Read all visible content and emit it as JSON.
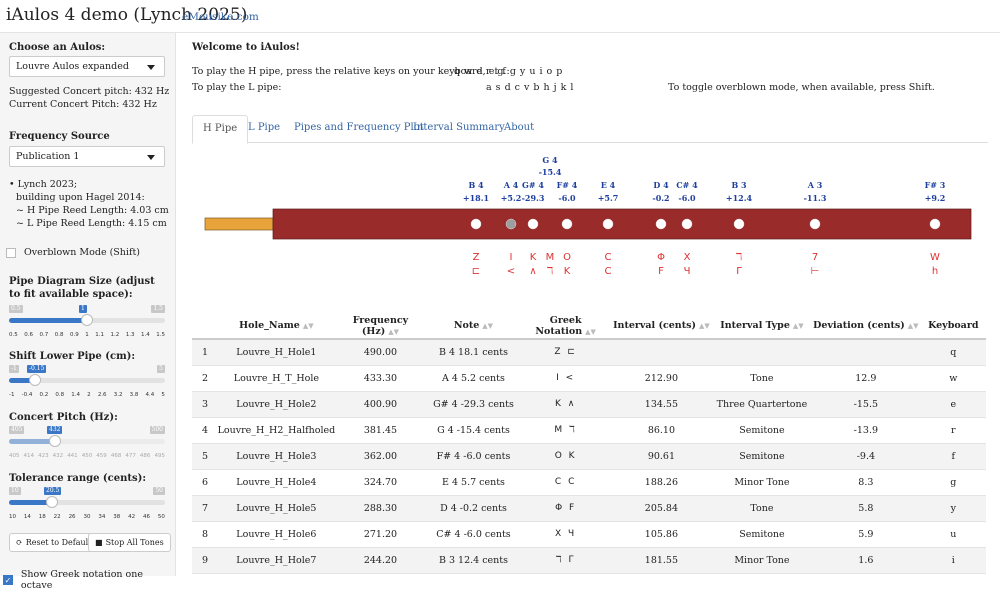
{
  "header": {
    "title": "iAulos 4 demo (Lynch 2025)",
    "link": "eMousike.com"
  },
  "sidebar": {
    "choose_label": "Choose an Aulos:",
    "aulos_selected": "Louvre Aulos expanded",
    "suggested_pitch": "Suggested Concert pitch: 432 Hz",
    "current_pitch": "Current Concert Pitch: 432 Hz",
    "freq_label": "Frequency Source",
    "freq_selected": "Publication 1",
    "source_lines": [
      "• Lynch 2023;",
      "building upon Hagel 2014:",
      "~ H Pipe Reed Length: 4.03 cm",
      "~ L Pipe Reed Length: 4.15 cm"
    ],
    "overblown_label": "Overblown Mode (Shift)",
    "diagram_label": "Pipe Diagram Size (adjust to fit available space):",
    "diagram_slider": {
      "min": "0.5",
      "max": "1.5",
      "value": "1",
      "fraction": 0.5,
      "ticks": [
        "0.5",
        "0.6",
        "0.7",
        "0.8",
        "0.9",
        "1",
        "1.1",
        "1.2",
        "1.3",
        "1.4",
        "1.5"
      ]
    },
    "shift_label": "Shift Lower Pipe (cm):",
    "shift_slider": {
      "min": "-1",
      "max": "5",
      "value": "-0.15",
      "fraction": 0.14,
      "ticks": [
        "-1",
        "-0.4",
        "0.2",
        "0.8",
        "1.4",
        "2",
        "2.6",
        "3.2",
        "3.8",
        "4.4",
        "5"
      ]
    },
    "concert_label": "Concert Pitch (Hz):",
    "concert_slider": {
      "min": "405",
      "max": "500",
      "value": "432",
      "fraction": 0.28,
      "ticks": [
        "405",
        "414",
        "423",
        "432",
        "441",
        "450",
        "459",
        "468",
        "477",
        "486",
        "495"
      ]
    },
    "tolerance_label": "Tolerance range (cents):",
    "tolerance_slider": {
      "min": "10",
      "max": "50",
      "value": "20.5",
      "fraction": 0.26,
      "ticks": [
        "10",
        "14",
        "18",
        "22",
        "26",
        "30",
        "34",
        "38",
        "42",
        "46",
        "50"
      ]
    },
    "reset_label": "Reset to Default",
    "stop_label": "Stop All Tones",
    "greek_checkbox_label": "Show Greek notation one octave"
  },
  "main": {
    "welcome": "Welcome to iAulos!",
    "h_instr": "To play the H pipe, press the relative keys on your keyboard, e.g.:",
    "h_keys": "q w e r t f g y u i o p",
    "l_instr": "To play the L pipe:",
    "l_keys": "a s d c v b h j k l",
    "overblown_instr": "To toggle overblown mode, when available, press Shift.",
    "tabs": [
      "H Pipe",
      "L Pipe",
      "Pipes and Frequency Plot",
      "Interval Summary",
      "About"
    ]
  },
  "pipe": {
    "body_color": "#9a2b2b",
    "reed_color": "#e8a33a",
    "label_color": "#1f3fa0",
    "greek_color": "#e03030",
    "holes": [
      {
        "note": "B 4",
        "cents": "+18.1",
        "greek_top": "Z",
        "greek_bottom": "⊏"
      },
      {
        "note": "A 4",
        "cents": "+5.2",
        "greek_top": "I",
        "greek_bottom": "<"
      },
      {
        "note": "G# 4",
        "cents": "-29.3",
        "greek_top": "K",
        "greek_bottom": "∧"
      },
      {
        "note": "G 4",
        "cents": "-15.4",
        "greek_top": "M",
        "greek_bottom": "ℸ"
      },
      {
        "note": "F# 4",
        "cents": "-6.0",
        "greek_top": "O",
        "greek_bottom": "K"
      },
      {
        "note": "E 4",
        "cents": "+5.7",
        "greek_top": "C",
        "greek_bottom": "C"
      },
      {
        "note": "D 4",
        "cents": "-0.2",
        "greek_top": "Φ",
        "greek_bottom": "F"
      },
      {
        "note": "C# 4",
        "cents": "-6.0",
        "greek_top": "X",
        "greek_bottom": "Ч"
      },
      {
        "note": "B 3",
        "cents": "+12.4",
        "greek_top": "ℸ",
        "greek_bottom": "Γ"
      },
      {
        "note": "A 3",
        "cents": "-11.3",
        "greek_top": "7",
        "greek_bottom": "⊢"
      },
      {
        "note": "F# 3",
        "cents": "+9.2",
        "greek_top": "W",
        "greek_bottom": "h"
      }
    ]
  },
  "table": {
    "columns": [
      "Hole_Name",
      "Frequency (Hz)",
      "Note",
      "Greek Notation",
      "Interval (cents)",
      "Interval Type",
      "Deviation (cents)",
      "Keyboard"
    ],
    "rows": [
      [
        "1",
        "Louvre_H_Hole1",
        "490.00",
        "B 4 18.1 cents",
        "Z ⊏",
        "",
        "",
        "",
        "q"
      ],
      [
        "2",
        "Louvre_H_T_Hole",
        "433.30",
        "A 4 5.2 cents",
        "I <",
        "212.90",
        "Tone",
        "12.9",
        "w"
      ],
      [
        "3",
        "Louvre_H_Hole2",
        "400.90",
        "G# 4 -29.3 cents",
        "K ∧",
        "134.55",
        "Three Quartertone",
        "-15.5",
        "e"
      ],
      [
        "4",
        "Louvre_H_H2_Halfholed",
        "381.45",
        "G 4 -15.4 cents",
        "M ℸ",
        "86.10",
        "Semitone",
        "-13.9",
        "r"
      ],
      [
        "5",
        "Louvre_H_Hole3",
        "362.00",
        "F# 4 -6.0 cents",
        "O K",
        "90.61",
        "Semitone",
        "-9.4",
        "f"
      ],
      [
        "6",
        "Louvre_H_Hole4",
        "324.70",
        "E 4 5.7 cents",
        "C C",
        "188.26",
        "Minor Tone",
        "8.3",
        "g"
      ],
      [
        "7",
        "Louvre_H_Hole5",
        "288.30",
        "D 4 -0.2 cents",
        "Φ F",
        "205.84",
        "Tone",
        "5.8",
        "y"
      ],
      [
        "8",
        "Louvre_H_Hole6",
        "271.20",
        "C# 4 -6.0 cents",
        "X Ч",
        "105.86",
        "Semitone",
        "5.9",
        "u"
      ],
      [
        "9",
        "Louvre_H_Hole7",
        "244.20",
        "B 3 12.4 cents",
        "ℸ Γ",
        "181.55",
        "Minor Tone",
        "1.6",
        "i"
      ]
    ]
  }
}
